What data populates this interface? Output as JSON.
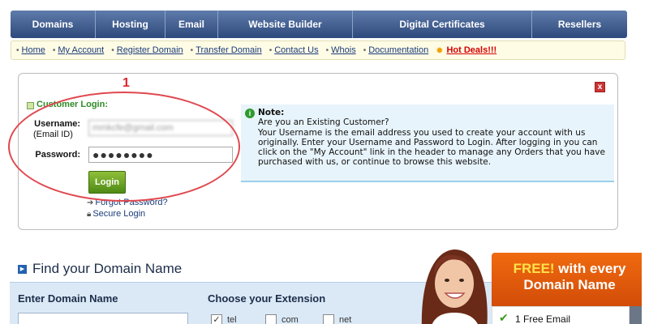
{
  "top_nav": [
    "Domains",
    "Hosting",
    "Email",
    "Website Builder",
    "Digital Certificates",
    "Resellers"
  ],
  "sub_nav": [
    {
      "label": "Home"
    },
    {
      "label": "My Account"
    },
    {
      "label": "Register Domain"
    },
    {
      "label": "Transfer Domain"
    },
    {
      "label": "Contact Us"
    },
    {
      "label": "Whois"
    },
    {
      "label": "Documentation"
    }
  ],
  "hot_deals": "Hot Deals!!!",
  "login": {
    "close": "x",
    "title": "Customer Login:",
    "username_label": "Username:",
    "username_sublabel": "(Email ID)",
    "username_value": "mmkcfe@gmail.com",
    "password_label": "Password:",
    "password_value": "●●●●●●●●",
    "button": "Login",
    "forgot": "Forgot Password?",
    "secure": "Secure Login"
  },
  "annotation": {
    "number": "1"
  },
  "note": {
    "title": "Note:",
    "lines": [
      "Are you an Existing Customer?",
      "Your Username is the email address you used to create your account with us originally. Enter your Username and Password to Login. After logging in you can click on the \"My Account\" link in the header to manage any Orders that you have purchased with us, or continue to browse this website."
    ]
  },
  "domain_search": {
    "title": "Find your Domain Name",
    "enter_label": "Enter Domain Name",
    "ext_label": "Choose your Extension",
    "extensions": [
      {
        "label": "tel",
        "checked": "✓"
      },
      {
        "label": "com",
        "checked": ""
      },
      {
        "label": "net",
        "checked": ""
      }
    ]
  },
  "promo": {
    "free": "FREE!",
    "rest": " with every Domain Name",
    "item": "1 Free Email"
  }
}
